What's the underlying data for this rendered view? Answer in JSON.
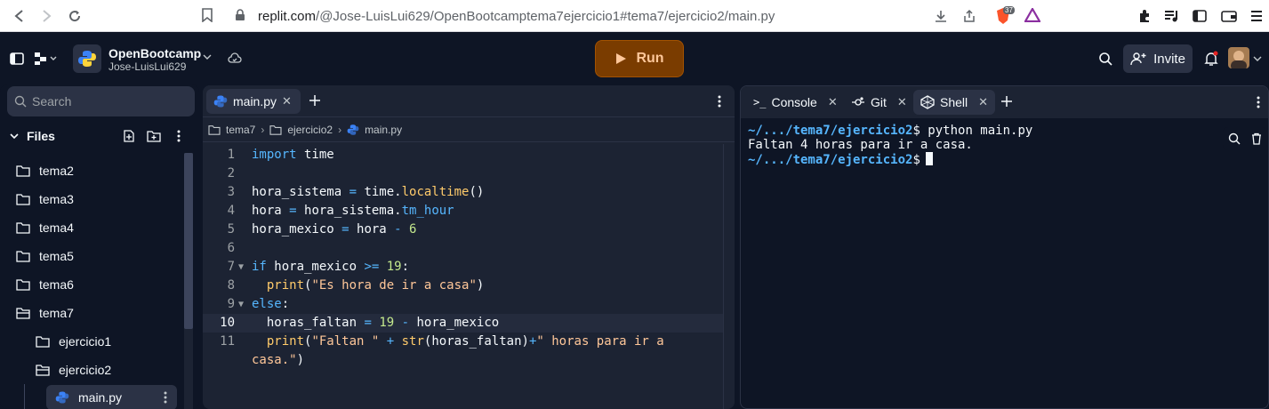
{
  "browser": {
    "url_host": "replit.com",
    "url_path": "/@Jose-LuisLui629/OpenBootcamptema7ejercicio1#tema7/ejercicio2/main.py",
    "extension_badge": "37"
  },
  "header": {
    "repl_title": "OpenBootcamp",
    "repl_owner": "Jose-LuisLui629",
    "run_label": "Run",
    "invite_label": "Invite"
  },
  "sidebar": {
    "search_placeholder": "Search",
    "files_label": "Files",
    "items": [
      {
        "label": "tema2"
      },
      {
        "label": "tema3"
      },
      {
        "label": "tema4"
      },
      {
        "label": "tema5"
      },
      {
        "label": "tema6"
      },
      {
        "label": "tema7"
      },
      {
        "label": "ejercicio1"
      },
      {
        "label": "ejercicio2"
      },
      {
        "label": "main.py"
      }
    ]
  },
  "editor": {
    "tab_label": "main.py",
    "breadcrumbs": [
      "tema7",
      "ejercicio2",
      "main.py"
    ],
    "line_numbers": [
      "1",
      "2",
      "3",
      "4",
      "5",
      "6",
      "7",
      "8",
      "9",
      "10",
      "11"
    ]
  },
  "shell": {
    "tabs": [
      {
        "label": "Console"
      },
      {
        "label": "Git"
      },
      {
        "label": "Shell"
      }
    ],
    "prompt": "~/.../tema7/ejercicio2",
    "command": "$ python main.py",
    "output": "Faltan 4 horas para ir a casa.",
    "prompt2": "~/.../tema7/ejercicio2",
    "dollar": "$"
  },
  "colors": {
    "background": "#0e1525",
    "panel": "#1c2333",
    "run_button": "#7a3c00",
    "keyword": "#56b6fe",
    "string": "#ffc799",
    "number": "#c3e88d",
    "function": "#ffcb6b"
  }
}
